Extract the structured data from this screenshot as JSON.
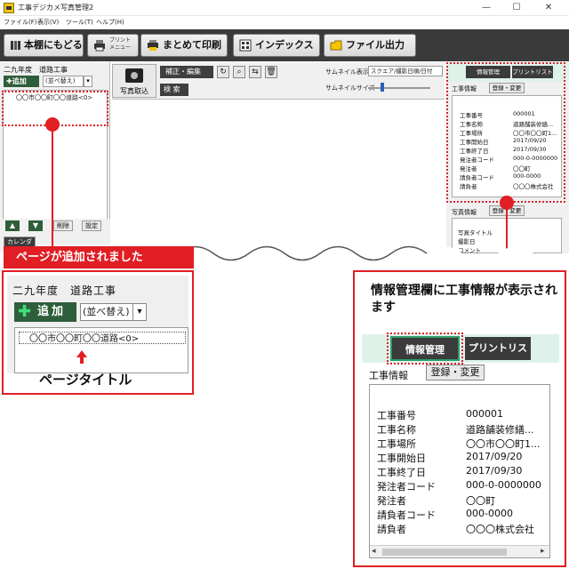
{
  "window": {
    "title": "工事デジカメ写真管理2",
    "minimize": "—",
    "maximize": "☐",
    "close": "✕"
  },
  "menu": [
    "ファイル(F)",
    "表示(V)",
    "ツール(T)",
    "ヘルプ(H)"
  ],
  "toolbar": {
    "back": "本棚にもどる",
    "print_menu_line1": "プリント",
    "print_menu_line2": "メニュー",
    "bulk_print": "まとめて印刷",
    "index": "インデックス",
    "file_output": "ファイル出力"
  },
  "left_panel": {
    "title": "二九年度　道路工事",
    "add": "✚追加",
    "sort": "(並べ替え)",
    "item": "〇〇市〇〇町〇〇道路<0>",
    "delete": "削除",
    "settings": "設定",
    "calendar": "カレンダ"
  },
  "center": {
    "photo_import": "写真取込",
    "edit": "補正・編集",
    "search": "検 索",
    "thumb_display_label": "サムネイル表示",
    "thumb_display_value": "スクエア/撮影日順/日付",
    "thumb_size_label": "サムネイルサイズ"
  },
  "right_panel": {
    "tab_info": "情報管理",
    "tab_print": "プリントリスト",
    "section": "工事情報",
    "register": "登録・変更",
    "photo_section": "写真情報",
    "photo_register": "登録・変更",
    "photo_rows": [
      "写真タイトル",
      "撮影日",
      "コメント"
    ]
  },
  "construction_info": [
    {
      "label": "工事番号",
      "value": "000001"
    },
    {
      "label": "工事名称",
      "value": "道路舗装修繕..."
    },
    {
      "label": "工事場所",
      "value": "〇〇市〇〇町1..."
    },
    {
      "label": "工事開始日",
      "value": "2017/09/20"
    },
    {
      "label": "工事終了日",
      "value": "2017/09/30"
    },
    {
      "label": "発注者コード",
      "value": "000-0-0000000"
    },
    {
      "label": "発注者",
      "value": "〇〇町"
    },
    {
      "label": "請負者コード",
      "value": "000-0000"
    },
    {
      "label": "請負者",
      "value": "〇〇〇株式会社"
    }
  ],
  "callouts": {
    "banner": "ページが追加されました",
    "page_title_caption": "ページタイトル",
    "info_desc": "情報管理欄に工事情報が表示されます"
  },
  "zoom_left": {
    "title": "二九年度　道路工事",
    "add": "追加",
    "sort": "(並べ替え)",
    "item": "〇〇市〇〇町〇〇道路<0>"
  },
  "zoom_right": {
    "tab_info": "情報管理",
    "tab_print": "プリントリスト",
    "section": "工事情報",
    "register": "登録・変更"
  },
  "zoom_info": [
    {
      "label": "工事番号",
      "value": "000001"
    },
    {
      "label": "工事名称",
      "value": "道路舗装修繕..."
    },
    {
      "label": "工事場所",
      "value": "〇〇市〇〇町1..."
    },
    {
      "label": "工事開始日",
      "value": "2017/09/20"
    },
    {
      "label": "工事終了日",
      "value": "2017/09/30"
    },
    {
      "label": "発注者コード",
      "value": "000-0-0000000"
    },
    {
      "label": "発注者",
      "value": "〇〇町"
    },
    {
      "label": "請負者コード",
      "value": "000-0000"
    },
    {
      "label": "請負者",
      "value": "〇〇〇株式会社"
    }
  ],
  "colors": {
    "accent_red": "#e01e24",
    "toolbar_dark": "#3a3a3a",
    "green_button": "#2e5e3a",
    "tab_bg": "#dff2ea"
  }
}
